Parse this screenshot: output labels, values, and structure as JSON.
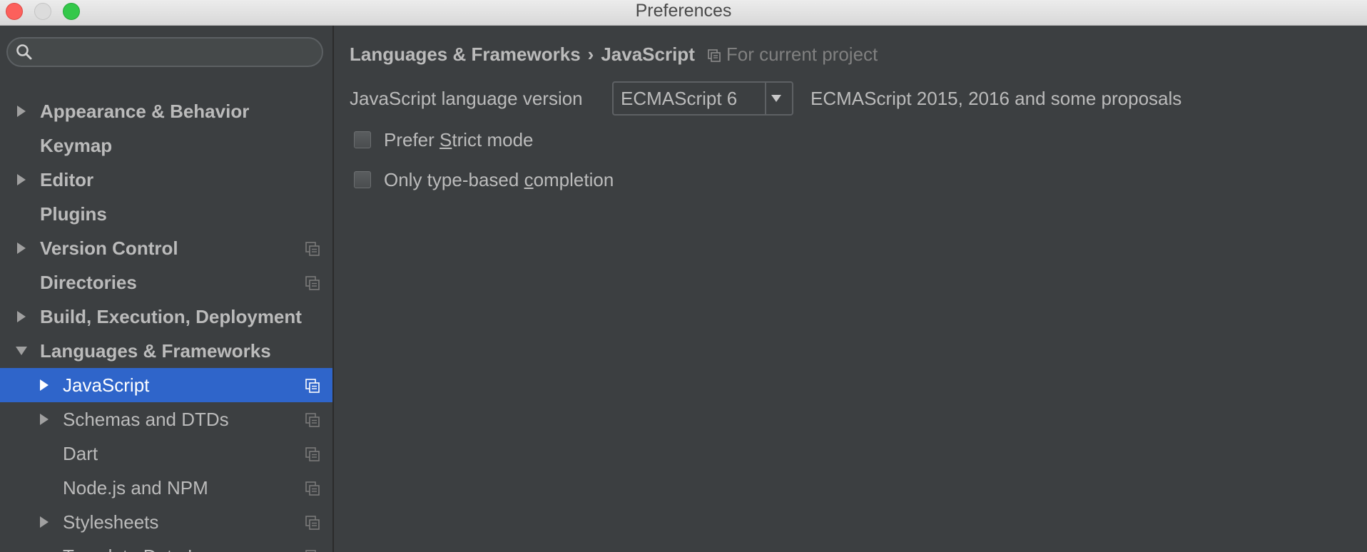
{
  "window": {
    "title": "Preferences"
  },
  "search": {
    "value": "",
    "placeholder": ""
  },
  "sidebar": {
    "items": [
      {
        "label": "Appearance & Behavior",
        "expanded": false,
        "has_arrow": true,
        "level": 0,
        "project_icon": false
      },
      {
        "label": "Keymap",
        "expanded": false,
        "has_arrow": false,
        "level": 0,
        "project_icon": false
      },
      {
        "label": "Editor",
        "expanded": false,
        "has_arrow": true,
        "level": 0,
        "project_icon": false
      },
      {
        "label": "Plugins",
        "expanded": false,
        "has_arrow": false,
        "level": 0,
        "project_icon": false
      },
      {
        "label": "Version Control",
        "expanded": false,
        "has_arrow": true,
        "level": 0,
        "project_icon": true
      },
      {
        "label": "Directories",
        "expanded": false,
        "has_arrow": false,
        "level": 0,
        "project_icon": true
      },
      {
        "label": "Build, Execution, Deployment",
        "expanded": false,
        "has_arrow": true,
        "level": 0,
        "project_icon": false
      },
      {
        "label": "Languages & Frameworks",
        "expanded": true,
        "has_arrow": true,
        "level": 0,
        "project_icon": false
      },
      {
        "label": "JavaScript",
        "expanded": false,
        "has_arrow": true,
        "level": 1,
        "project_icon": true,
        "selected": true
      },
      {
        "label": "Schemas and DTDs",
        "expanded": false,
        "has_arrow": true,
        "level": 1,
        "project_icon": true
      },
      {
        "label": "Dart",
        "expanded": false,
        "has_arrow": false,
        "level": 1,
        "project_icon": true
      },
      {
        "label": "Node.js and NPM",
        "expanded": false,
        "has_arrow": false,
        "level": 1,
        "project_icon": true
      },
      {
        "label": "Stylesheets",
        "expanded": false,
        "has_arrow": true,
        "level": 1,
        "project_icon": true
      },
      {
        "label": "Template Data Languages",
        "expanded": false,
        "has_arrow": false,
        "level": 1,
        "project_icon": true
      }
    ]
  },
  "breadcrumb": {
    "parent": "Languages & Frameworks",
    "separator": "›",
    "current": "JavaScript",
    "scope": "For current project"
  },
  "settings": {
    "version_label": "JavaScript language version",
    "version_value": "ECMAScript 6",
    "version_description": "ECMAScript 2015, 2016 and some proposals",
    "checkboxes": [
      {
        "label_before": "Prefer ",
        "mnemonic": "S",
        "label_after": "trict mode",
        "checked": false
      },
      {
        "label_before": "Only type-based ",
        "mnemonic": "c",
        "label_after": "ompletion",
        "checked": false
      }
    ]
  },
  "colors": {
    "background": "#3c3f41",
    "selection": "#2f65ca",
    "text": "#bbbbbb",
    "muted_text": "#808080",
    "close": "#fc605c",
    "maximize": "#34c84a"
  },
  "icons": {
    "search": "search-icon",
    "expand": "triangle-right-icon",
    "collapse": "triangle-down-icon",
    "project_scope": "project-scope-icon",
    "dropdown": "triangle-down-icon"
  }
}
